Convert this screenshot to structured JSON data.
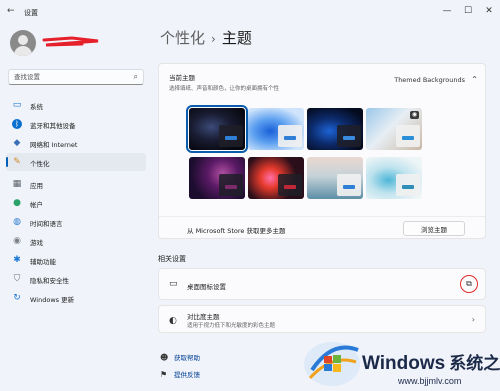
{
  "window": {
    "title": "设置",
    "controls": [
      "—",
      "☐",
      "✕"
    ]
  },
  "sidebar": {
    "search_placeholder": "查找设置",
    "items": [
      {
        "label": "系统",
        "icon": "monitor-icon",
        "active": false
      },
      {
        "label": "蓝牙和其他设备",
        "icon": "bluetooth-icon",
        "active": false
      },
      {
        "label": "网络和 Internet",
        "icon": "wifi-icon",
        "active": false
      },
      {
        "label": "个性化",
        "icon": "brush-icon",
        "active": true
      },
      {
        "label": "应用",
        "icon": "apps-icon",
        "active": false
      },
      {
        "label": "帐户",
        "icon": "account-icon",
        "active": false
      },
      {
        "label": "时间和语言",
        "icon": "globe-clock-icon",
        "active": false
      },
      {
        "label": "游戏",
        "icon": "gamepad-icon",
        "active": false
      },
      {
        "label": "辅助功能",
        "icon": "accessibility-icon",
        "active": false
      },
      {
        "label": "隐私和安全性",
        "icon": "shield-icon",
        "active": false
      },
      {
        "label": "Windows 更新",
        "icon": "update-icon",
        "active": false
      }
    ]
  },
  "breadcrumb": {
    "parent": "个性化",
    "separator": "›",
    "current": "主题"
  },
  "current_theme": {
    "title": "当前主题",
    "description": "选择填纸、声音和颜色，让你的桌面拥有个性",
    "name": "Themed Backgrounds",
    "themes": [
      {
        "name": "dark-bloom",
        "selected": true,
        "accent": "#2f7fd6"
      },
      {
        "name": "windows-light",
        "selected": false,
        "accent": "#2f7fd6"
      },
      {
        "name": "windows-dark",
        "selected": false,
        "accent": "#3a8be0"
      },
      {
        "name": "glow",
        "selected": false,
        "accent": "#2a8fd8"
      },
      {
        "name": "captured-motion",
        "selected": false,
        "accent": "#7c2a6a"
      },
      {
        "name": "flow",
        "selected": false,
        "accent": "#c0283a"
      },
      {
        "name": "sunrise",
        "selected": false,
        "accent": "#2f7fd6"
      },
      {
        "name": "bloom-teal",
        "selected": false,
        "accent": "#2f8fb8"
      }
    ]
  },
  "store": {
    "text": "从 Microsoft Store 获取更多主题",
    "button": "浏览主题"
  },
  "related": {
    "title": "相关设置",
    "desktop_icons": "桌面图标设置",
    "contrast_title": "对比度主题",
    "contrast_desc": "适用于视力低下和光敏度的彩色主题"
  },
  "help": {
    "get_help": "获取帮助",
    "feedback": "提供反馈"
  },
  "watermark": {
    "brand": "Windows",
    "cn": "系统之家",
    "url": "www.bjjmlv.com"
  }
}
